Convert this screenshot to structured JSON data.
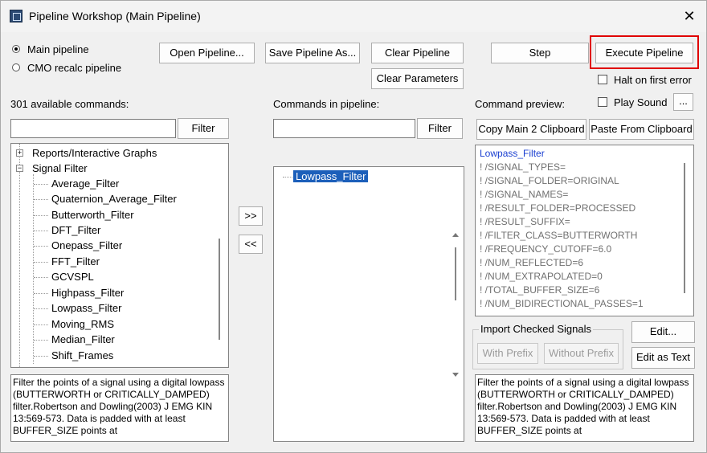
{
  "window": {
    "title": "Pipeline Workshop (Main Pipeline)",
    "close_glyph": "✕"
  },
  "mode": {
    "main_label": "Main pipeline",
    "cmo_label": "CMO recalc pipeline",
    "selected": "main"
  },
  "toolbar": {
    "open_label": "Open Pipeline...",
    "save_as_label": "Save Pipeline As...",
    "clear_pipeline_label": "Clear Pipeline",
    "clear_params_label": "Clear Parameters",
    "step_label": "Step",
    "execute_label": "Execute Pipeline"
  },
  "options": {
    "halt_label": "Halt on first error",
    "halt_checked": false,
    "play_sound_label": "Play Sound",
    "play_sound_checked": false,
    "sound_browse_label": "..."
  },
  "available": {
    "header": "301 available commands:",
    "filter_value": "",
    "filter_button": "Filter",
    "tree": [
      {
        "label": "Reports/Interactive Graphs",
        "level": 0,
        "expander": "+"
      },
      {
        "label": "Signal Filter",
        "level": 0,
        "expander": "−"
      },
      {
        "label": "Average_Filter",
        "level": 1
      },
      {
        "label": "Quaternion_Average_Filter",
        "level": 1
      },
      {
        "label": "Butterworth_Filter",
        "level": 1
      },
      {
        "label": "DFT_Filter",
        "level": 1
      },
      {
        "label": "Onepass_Filter",
        "level": 1
      },
      {
        "label": "FFT_Filter",
        "level": 1
      },
      {
        "label": "GCVSPL",
        "level": 1
      },
      {
        "label": "Highpass_Filter",
        "level": 1
      },
      {
        "label": "Lowpass_Filter",
        "level": 1
      },
      {
        "label": "Moving_RMS",
        "level": 1
      },
      {
        "label": "Median_Filter",
        "level": 1
      },
      {
        "label": "Shift_Frames",
        "level": 1
      }
    ],
    "description": "Filter the points of a signal using a digital lowpass (BUTTERWORTH or CRITICALLY_DAMPED) filter.Robertson and Dowling(2003) J EMG KIN 13:569-573. Data is padded with at least BUFFER_SIZE points at"
  },
  "transfer": {
    "add_label": ">>",
    "remove_label": "<<"
  },
  "pipeline": {
    "header": "Commands in pipeline:",
    "filter_value": "",
    "filter_button": "Filter",
    "items": [
      "Lowpass_Filter"
    ]
  },
  "preview": {
    "header": "Command preview:",
    "copy_label": "Copy Main 2 Clipboard",
    "paste_label": "Paste From Clipboard",
    "lines": [
      "Lowpass_Filter",
      "! /SIGNAL_TYPES=",
      "! /SIGNAL_FOLDER=ORIGINAL",
      "! /SIGNAL_NAMES=",
      "! /RESULT_FOLDER=PROCESSED",
      "! /RESULT_SUFFIX=",
      "! /FILTER_CLASS=BUTTERWORTH",
      "! /FREQUENCY_CUTOFF=6.0",
      "! /NUM_REFLECTED=6",
      "! /NUM_EXTRAPOLATED=0",
      "! /TOTAL_BUFFER_SIZE=6",
      "! /NUM_BIDIRECTIONAL_PASSES=1"
    ],
    "command_color": "#1a3fd1",
    "param_color": "#707070",
    "import_group_label": "Import Checked Signals",
    "with_prefix_label": "With Prefix",
    "without_prefix_label": "Without Prefix",
    "edit_label": "Edit...",
    "edit_text_label": "Edit as Text",
    "description": "Filter the points of a signal using a digital lowpass (BUTTERWORTH or CRITICALLY_DAMPED) filter.Robertson and Dowling(2003) J EMG KIN 13:569-573. Data is padded with at least BUFFER_SIZE points at"
  },
  "colors": {
    "highlight": "#e00000",
    "selection": "#1c5fba"
  }
}
